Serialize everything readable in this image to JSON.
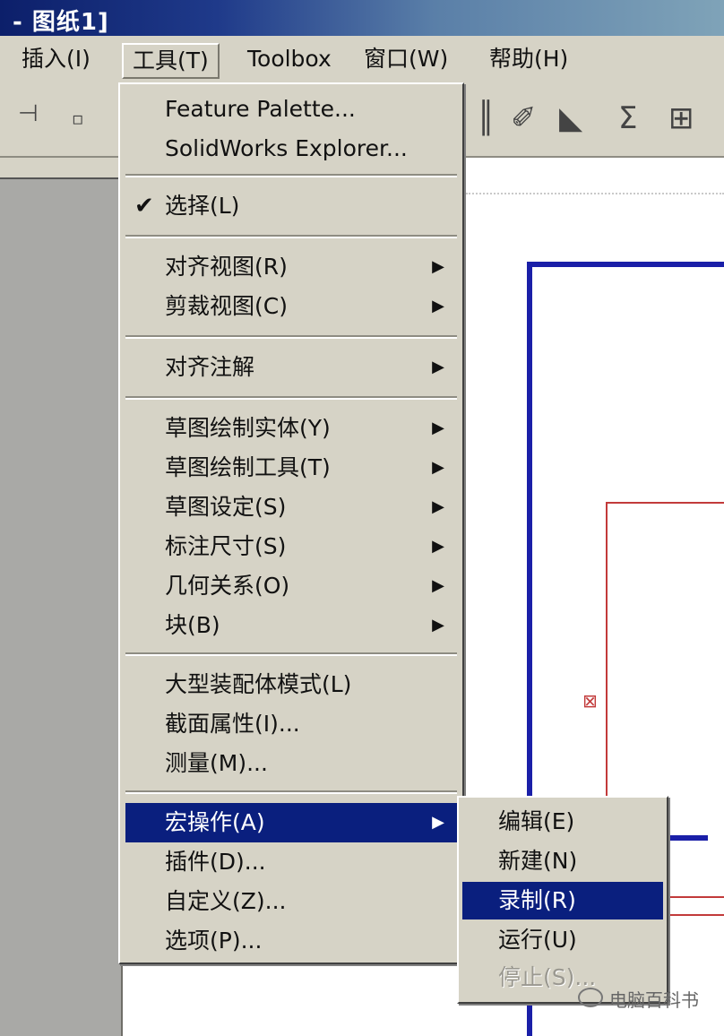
{
  "window": {
    "title": "- 图纸1]"
  },
  "menubar": {
    "items": [
      {
        "label": "插入(I)"
      },
      {
        "label": "工具(T)"
      },
      {
        "label": "Toolbox"
      },
      {
        "label": "窗口(W)"
      },
      {
        "label": "帮助(H)"
      }
    ]
  },
  "tools_menu": {
    "items": [
      {
        "label": "Feature Palette..."
      },
      {
        "label": "SolidWorks Explorer..."
      },
      {
        "label": "选择(L)"
      },
      {
        "label": "对齐视图(R)"
      },
      {
        "label": "剪裁视图(C)"
      },
      {
        "label": "对齐注解"
      },
      {
        "label": "草图绘制实体(Y)"
      },
      {
        "label": "草图绘制工具(T)"
      },
      {
        "label": "草图设定(S)"
      },
      {
        "label": "标注尺寸(S)"
      },
      {
        "label": "几何关系(O)"
      },
      {
        "label": "块(B)"
      },
      {
        "label": "大型装配体模式(L)"
      },
      {
        "label": "截面属性(I)..."
      },
      {
        "label": "测量(M)..."
      },
      {
        "label": "宏操作(A)"
      },
      {
        "label": "插件(D)..."
      },
      {
        "label": "自定义(Z)..."
      },
      {
        "label": "选项(P)..."
      }
    ]
  },
  "macro_submenu": {
    "items": [
      {
        "label": "编辑(E)"
      },
      {
        "label": "新建(N)"
      },
      {
        "label": "录制(R)"
      },
      {
        "label": "运行(U)"
      },
      {
        "label": "停止(S)..."
      }
    ]
  },
  "watermark": {
    "text": "电脑百科书"
  },
  "icons": {
    "check": "checkmark-icon",
    "submenu_arrow": "triangle-right-icon"
  },
  "colors": {
    "menu_bg": "#d6d3c6",
    "highlight": "#0a1f7e",
    "frame_blue": "#1a1fa8",
    "sketch_red": "#c23a3a"
  }
}
